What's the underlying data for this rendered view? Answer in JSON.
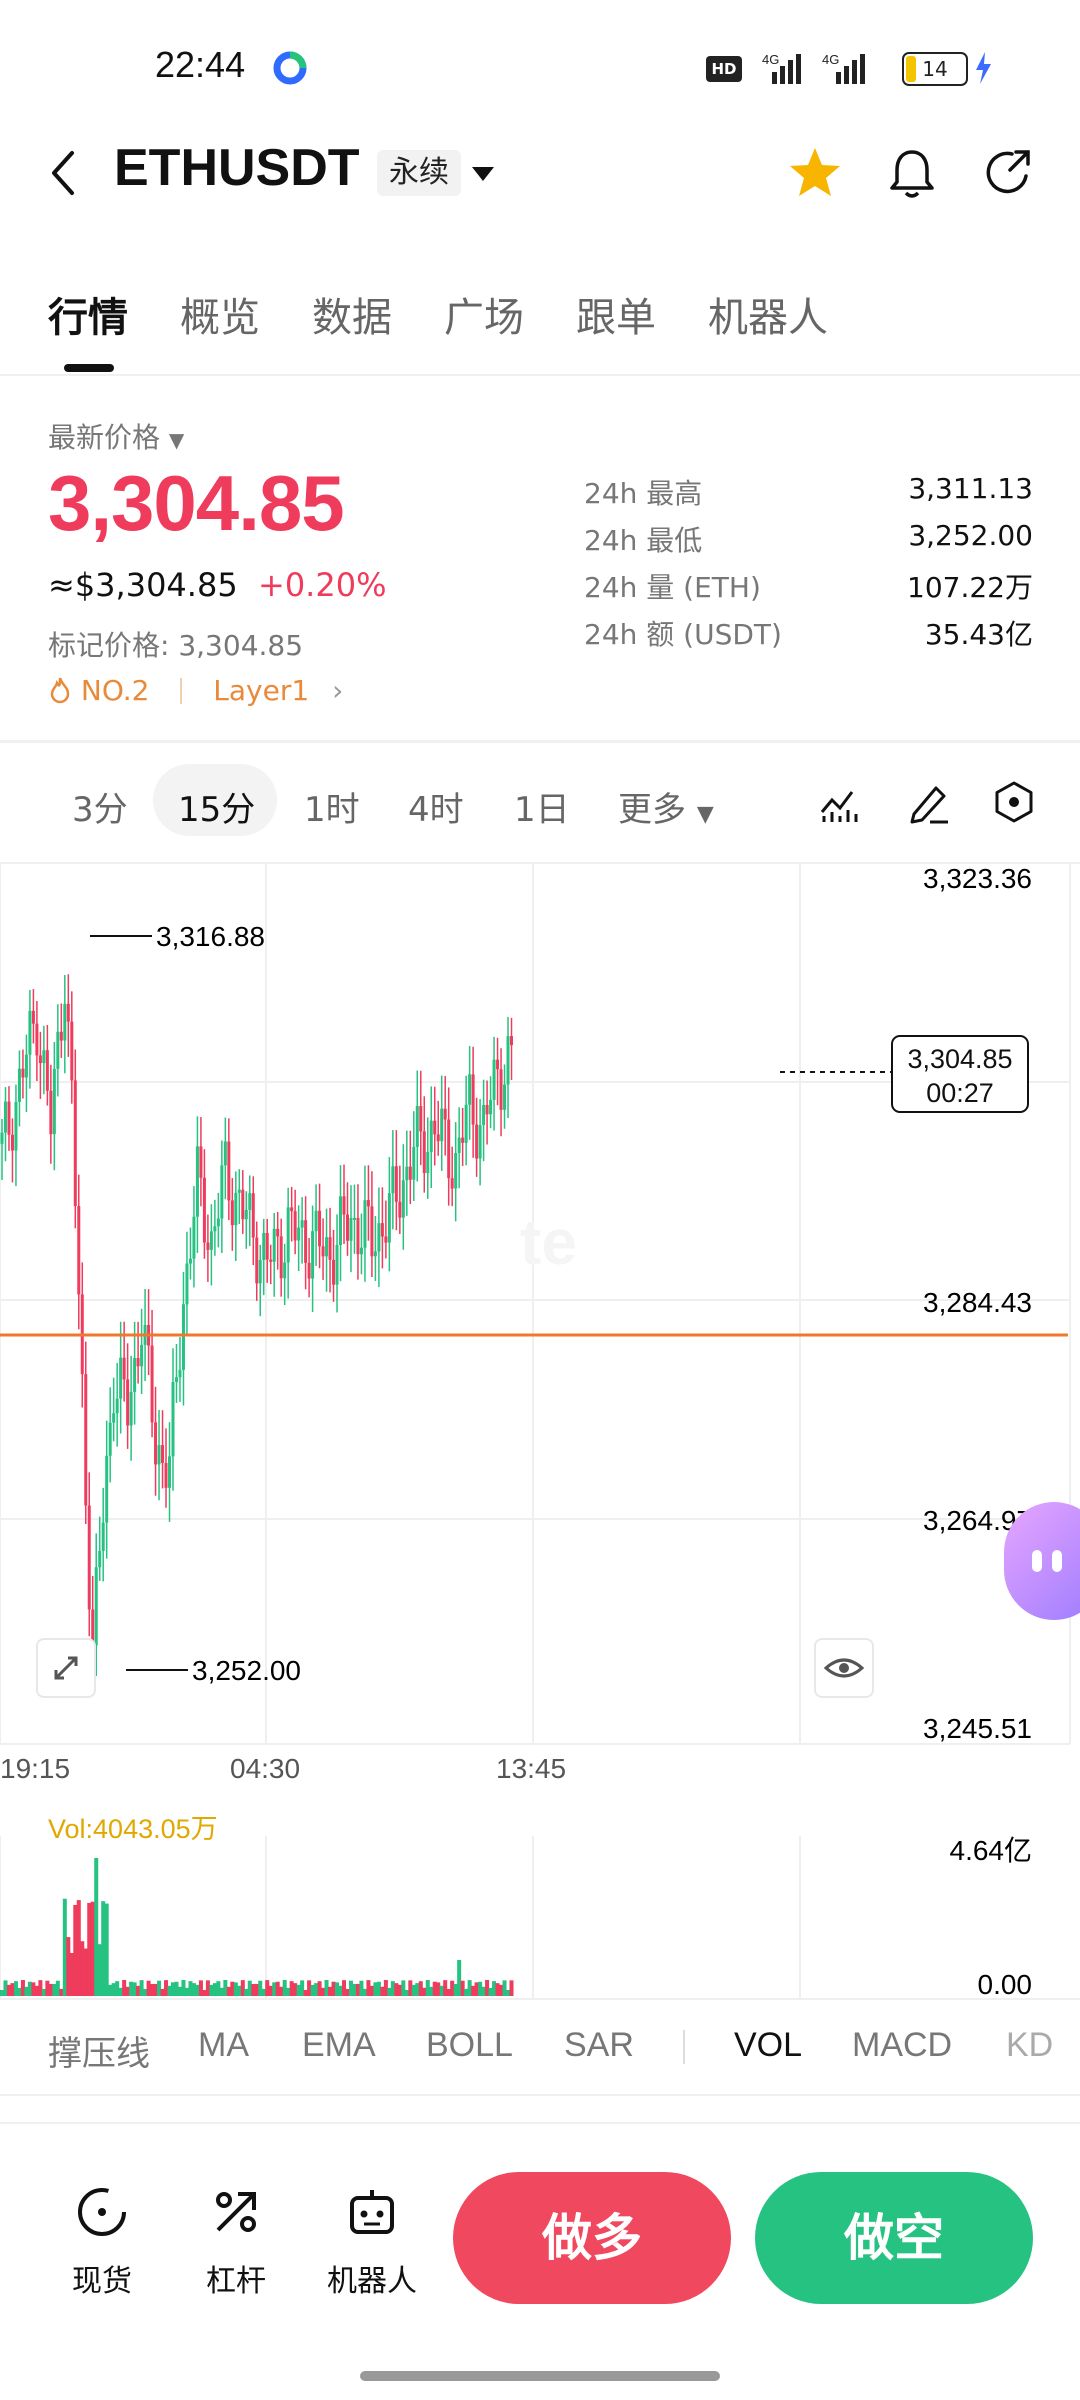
{
  "status_bar": {
    "time": "22:44",
    "battery": "14",
    "network": "4G"
  },
  "header": {
    "title": "ETHUSDT",
    "contract_type": "永续"
  },
  "tabs": [
    {
      "label": "行情",
      "active": true
    },
    {
      "label": "概览"
    },
    {
      "label": "数据"
    },
    {
      "label": "广场"
    },
    {
      "label": "跟单"
    },
    {
      "label": "机器人"
    }
  ],
  "price": {
    "latest_label": "最新价格",
    "last": "3,304.85",
    "usd": "≈$3,304.85",
    "change": "+0.20%",
    "mark_label": "标记价格:",
    "mark_value": "3,304.85",
    "rank": "NO.2",
    "sector": "Layer1"
  },
  "stats": [
    {
      "label": "24h  最高",
      "value": "3,311.13"
    },
    {
      "label": "24h  最低",
      "value": "3,252.00"
    },
    {
      "label": "24h  量 (ETH)",
      "value": "107.22万"
    },
    {
      "label": "24h  额 (USDT)",
      "value": "35.43亿"
    }
  ],
  "timeframes": [
    {
      "label": "3分"
    },
    {
      "label": "15分",
      "active": true
    },
    {
      "label": "1时"
    },
    {
      "label": "4时"
    },
    {
      "label": "1日"
    },
    {
      "label": "更多"
    }
  ],
  "chart": {
    "y_ticks": [
      "3,323.36",
      "3,284.43",
      "3,264.97",
      "3,245.51"
    ],
    "x_ticks": [
      "19:15",
      "04:30",
      "13:45"
    ],
    "high_label": "3,316.88",
    "low_label": "3,252.00",
    "current_price": "3,304.85",
    "countdown": "00:27",
    "watermark": "te",
    "colors": {
      "up": "#26c281",
      "down": "#ef3b5c",
      "line": "#f0782a"
    }
  },
  "volume": {
    "label": "Vol:4043.05万",
    "max_tick": "4.64亿",
    "min_tick": "0.00"
  },
  "indicators": [
    {
      "label": "撑压线"
    },
    {
      "label": "MA"
    },
    {
      "label": "EMA"
    },
    {
      "label": "BOLL"
    },
    {
      "label": "SAR"
    },
    {
      "label": "VOL",
      "active": true
    },
    {
      "label": "MACD"
    },
    {
      "label": "KD"
    }
  ],
  "bottom_bar": {
    "spot": "现货",
    "leverage": "杠杆",
    "robot": "机器人",
    "long": "做多",
    "short": "做空"
  }
}
